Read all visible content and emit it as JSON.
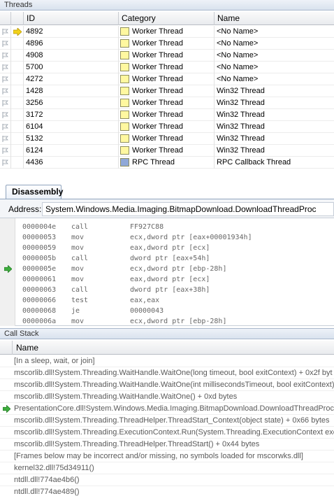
{
  "threads": {
    "title": "Threads",
    "columns": {
      "id": "ID",
      "category": "Category",
      "name": "Name"
    },
    "rows": [
      {
        "id": "4892",
        "category": "Worker Thread",
        "name": "<No Name>",
        "current": true,
        "color": "#fff8a0"
      },
      {
        "id": "4896",
        "category": "Worker Thread",
        "name": "<No Name>",
        "current": false,
        "color": "#fff8a0"
      },
      {
        "id": "4908",
        "category": "Worker Thread",
        "name": "<No Name>",
        "current": false,
        "color": "#fff8a0"
      },
      {
        "id": "5700",
        "category": "Worker Thread",
        "name": "<No Name>",
        "current": false,
        "color": "#fff8a0"
      },
      {
        "id": "4272",
        "category": "Worker Thread",
        "name": "<No Name>",
        "current": false,
        "color": "#fff8a0"
      },
      {
        "id": "1428",
        "category": "Worker Thread",
        "name": "Win32 Thread",
        "current": false,
        "color": "#fff8a0"
      },
      {
        "id": "3256",
        "category": "Worker Thread",
        "name": "Win32 Thread",
        "current": false,
        "color": "#fff8a0"
      },
      {
        "id": "3172",
        "category": "Worker Thread",
        "name": "Win32 Thread",
        "current": false,
        "color": "#fff8a0"
      },
      {
        "id": "6104",
        "category": "Worker Thread",
        "name": "Win32 Thread",
        "current": false,
        "color": "#fff8a0"
      },
      {
        "id": "5132",
        "category": "Worker Thread",
        "name": "Win32 Thread",
        "current": false,
        "color": "#fff8a0"
      },
      {
        "id": "6124",
        "category": "Worker Thread",
        "name": "Win32 Thread",
        "current": false,
        "color": "#fff8a0"
      },
      {
        "id": "4436",
        "category": "RPC Thread",
        "name": "RPC Callback Thread",
        "current": false,
        "color": "#8fa8d8"
      }
    ]
  },
  "disassembly": {
    "tab_label": "Disassembly",
    "address_label": "Address:",
    "address_value": "System.Windows.Media.Imaging.BitmapDownload.DownloadThreadProc",
    "lines": [
      {
        "addr": "0000004e",
        "op": "call",
        "arg": "FF927C88",
        "current": false
      },
      {
        "addr": "00000053",
        "op": "mov",
        "arg": "ecx,dword ptr [eax+00001934h]",
        "current": false
      },
      {
        "addr": "00000059",
        "op": "mov",
        "arg": "eax,dword ptr [ecx]",
        "current": false
      },
      {
        "addr": "0000005b",
        "op": "call",
        "arg": "dword ptr [eax+54h]",
        "current": false
      },
      {
        "addr": "0000005e",
        "op": "mov",
        "arg": "ecx,dword ptr [ebp-28h]",
        "current": true
      },
      {
        "addr": "00000061",
        "op": "mov",
        "arg": "eax,dword ptr [ecx]",
        "current": false
      },
      {
        "addr": "00000063",
        "op": "call",
        "arg": "dword ptr [eax+38h]",
        "current": false
      },
      {
        "addr": "00000066",
        "op": "test",
        "arg": "eax,eax",
        "current": false
      },
      {
        "addr": "00000068",
        "op": "je",
        "arg": "00000043",
        "current": false
      },
      {
        "addr": "0000006a",
        "op": "mov",
        "arg": "ecx,dword ptr [ebp-28h]",
        "current": false
      }
    ]
  },
  "callstack": {
    "title": "Call Stack",
    "column": "Name",
    "rows": [
      {
        "text": "[In a sleep, wait, or join]",
        "current": false
      },
      {
        "text": "mscorlib.dll!System.Threading.WaitHandle.WaitOne(long timeout, bool exitContext) + 0x2f byt",
        "current": false
      },
      {
        "text": "mscorlib.dll!System.Threading.WaitHandle.WaitOne(int millisecondsTimeout, bool exitContext) +",
        "current": false
      },
      {
        "text": "mscorlib.dll!System.Threading.WaitHandle.WaitOne() + 0xd bytes",
        "current": false
      },
      {
        "text": "PresentationCore.dll!System.Windows.Media.Imaging.BitmapDownload.DownloadThreadProc()",
        "current": true
      },
      {
        "text": "mscorlib.dll!System.Threading.ThreadHelper.ThreadStart_Context(object state) + 0x66 bytes",
        "current": false
      },
      {
        "text": "mscorlib.dll!System.Threading.ExecutionContext.Run(System.Threading.ExecutionContext exe",
        "current": false
      },
      {
        "text": "mscorlib.dll!System.Threading.ThreadHelper.ThreadStart() + 0x44 bytes",
        "current": false
      },
      {
        "text": "[Frames below may be incorrect and/or missing, no symbols loaded for mscorwks.dll]",
        "current": false
      },
      {
        "text": "kernel32.dll!75d34911()",
        "current": false
      },
      {
        "text": "ntdll.dll!774ae4b6()",
        "current": false
      },
      {
        "text": "ntdll.dll!774ae489()",
        "current": false
      }
    ]
  }
}
